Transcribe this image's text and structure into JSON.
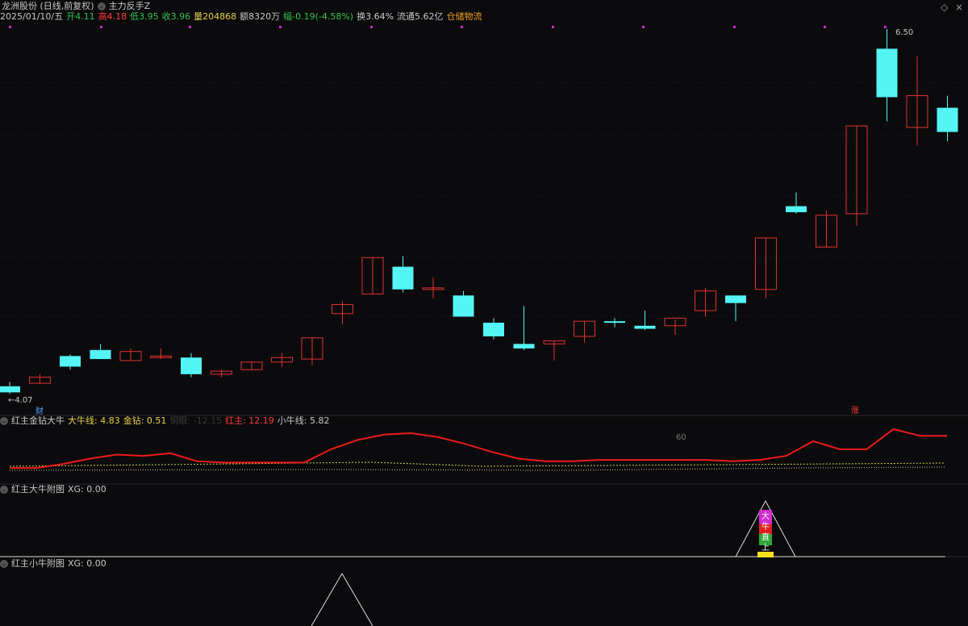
{
  "header": {
    "title": "龙洲股份 (日线,前复权)",
    "indicator": "主力反手Z",
    "date": "2025/01/10/五",
    "open": "开4.11",
    "high": "高4.18",
    "low": "低3.95",
    "close": "收3.96",
    "volume": "量204868",
    "amount": "额8320万",
    "change": "幅-0.19(-4.58%)",
    "turnover": "换3.64%",
    "float": "流通5.62亿",
    "concept": "仓储物流"
  },
  "main_chart": {
    "high_marker": "6.50",
    "low_marker": "←4.07",
    "fin_badge": "财",
    "up_badge": "涨",
    "candles": [
      {
        "o": 4.14,
        "h": 4.17,
        "l": 4.09,
        "c": 4.1
      },
      {
        "o": 4.16,
        "h": 4.22,
        "l": 4.16,
        "c": 4.2
      },
      {
        "o": 4.34,
        "h": 4.35,
        "l": 4.25,
        "c": 4.27
      },
      {
        "o": 4.38,
        "h": 4.42,
        "l": 4.32,
        "c": 4.32
      },
      {
        "o": 4.31,
        "h": 4.39,
        "l": 4.31,
        "c": 4.37
      },
      {
        "o": 4.33,
        "h": 4.39,
        "l": 4.32,
        "c": 4.34
      },
      {
        "o": 4.33,
        "h": 4.36,
        "l": 4.2,
        "c": 4.22
      },
      {
        "o": 4.22,
        "h": 4.25,
        "l": 4.2,
        "c": 4.24
      },
      {
        "o": 4.25,
        "h": 4.3,
        "l": 4.25,
        "c": 4.3
      },
      {
        "o": 4.3,
        "h": 4.36,
        "l": 4.27,
        "c": 4.33
      },
      {
        "o": 4.32,
        "h": 4.46,
        "l": 4.28,
        "c": 4.46
      },
      {
        "o": 4.62,
        "h": 4.7,
        "l": 4.55,
        "c": 4.68
      },
      {
        "o": 4.75,
        "h": 4.99,
        "l": 4.75,
        "c": 4.99
      },
      {
        "o": 4.93,
        "h": 5.0,
        "l": 4.76,
        "c": 4.78
      },
      {
        "o": 4.78,
        "h": 4.86,
        "l": 4.72,
        "c": 4.79
      },
      {
        "o": 4.74,
        "h": 4.77,
        "l": 4.6,
        "c": 4.6
      },
      {
        "o": 4.56,
        "h": 4.59,
        "l": 4.45,
        "c": 4.47
      },
      {
        "o": 4.42,
        "h": 4.67,
        "l": 4.38,
        "c": 4.39
      },
      {
        "o": 4.42,
        "h": 4.44,
        "l": 4.31,
        "c": 4.44
      },
      {
        "o": 4.47,
        "h": 4.57,
        "l": 4.43,
        "c": 4.57
      },
      {
        "o": 4.57,
        "h": 4.59,
        "l": 4.53,
        "c": 4.56
      },
      {
        "o": 4.54,
        "h": 4.64,
        "l": 4.51,
        "c": 4.52
      },
      {
        "o": 4.54,
        "h": 4.58,
        "l": 4.48,
        "c": 4.59
      },
      {
        "o": 4.64,
        "h": 4.79,
        "l": 4.6,
        "c": 4.77
      },
      {
        "o": 4.74,
        "h": 4.74,
        "l": 4.57,
        "c": 4.69
      },
      {
        "o": 4.78,
        "h": 5.12,
        "l": 4.72,
        "c": 5.12
      },
      {
        "o": 5.33,
        "h": 5.42,
        "l": 5.28,
        "c": 5.29
      },
      {
        "o": 5.06,
        "h": 5.3,
        "l": 5.06,
        "c": 5.27
      },
      {
        "o": 5.28,
        "h": 5.86,
        "l": 5.2,
        "c": 5.86
      },
      {
        "o": 6.37,
        "h": 6.5,
        "l": 5.89,
        "c": 6.05
      },
      {
        "o": 5.85,
        "h": 6.32,
        "l": 5.73,
        "c": 6.06
      },
      {
        "o": 5.98,
        "h": 6.06,
        "l": 5.76,
        "c": 5.82
      }
    ]
  },
  "panel1": {
    "name": "红主金钻大牛",
    "big_bull": "大牛线: 4.83",
    "gold": "金钻: 0.51",
    "hidden": "钢眼: -12.15",
    "red_main": "红主: 12.19",
    "small_bull": "小牛线: 5.82",
    "level_label": "60",
    "red_line": [
      12,
      12,
      18,
      26,
      32,
      30,
      34,
      22,
      20,
      20,
      20,
      20,
      40,
      54,
      62,
      64,
      58,
      48,
      36,
      26,
      22,
      22,
      24,
      24,
      24,
      24,
      24,
      22,
      24,
      30,
      52,
      40,
      40,
      70,
      60,
      60
    ]
  },
  "panel2": {
    "name": "红主大牛附图",
    "xg": "XG: 0.00",
    "signal_chars": [
      "大",
      "牛",
      "直",
      "上"
    ]
  },
  "panel3": {
    "name": "红主小牛附图",
    "xg": "XG: 0.00"
  },
  "colors": {
    "up": "#e0332e",
    "down": "#54f5f5",
    "line_red": "#ee1b1b",
    "line_yellow": "#d9cf4a",
    "magenta": "#d02bd0"
  },
  "icons": [
    "chevron-icon",
    "diamond-icon",
    "close-icon"
  ]
}
